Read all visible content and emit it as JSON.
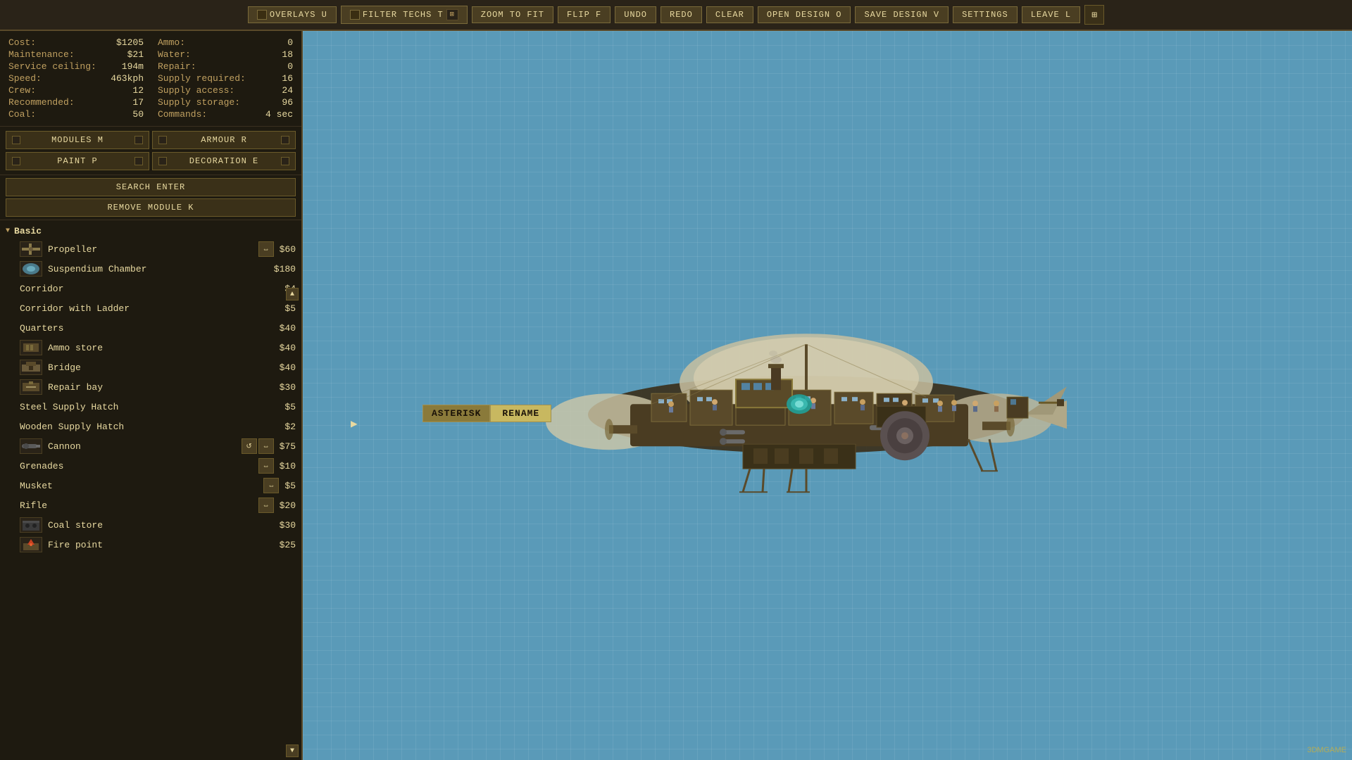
{
  "toolbar": {
    "buttons": [
      {
        "id": "overlays",
        "label": "Overlays U",
        "has_checkbox": true,
        "shortcut": "U"
      },
      {
        "id": "filter_techs",
        "label": "Filter Techs T",
        "has_checkbox": true,
        "shortcut": "T"
      },
      {
        "id": "zoom_fit",
        "label": "Zoom to fit",
        "shortcut": ""
      },
      {
        "id": "flip",
        "label": "Flip F",
        "shortcut": "F"
      },
      {
        "id": "undo",
        "label": "Undo",
        "shortcut": ""
      },
      {
        "id": "redo",
        "label": "Redo",
        "shortcut": ""
      },
      {
        "id": "clear",
        "label": "Clear",
        "shortcut": ""
      },
      {
        "id": "open_design",
        "label": "Open design O",
        "shortcut": "O"
      },
      {
        "id": "save_design",
        "label": "Save design V",
        "shortcut": "V"
      },
      {
        "id": "settings",
        "label": "Settings",
        "shortcut": ""
      },
      {
        "id": "leave",
        "label": "Leave L",
        "shortcut": "L"
      }
    ]
  },
  "stats": {
    "left": [
      {
        "label": "Cost:",
        "value": "$1205"
      },
      {
        "label": "Maintenance:",
        "value": "$21"
      },
      {
        "label": "Service ceiling:",
        "value": "194m"
      },
      {
        "label": "Speed:",
        "value": "463kph"
      },
      {
        "label": "Crew:",
        "value": "12"
      },
      {
        "label": "Recommended:",
        "value": "17"
      },
      {
        "label": "Coal:",
        "value": "50"
      }
    ],
    "right": [
      {
        "label": "Ammo:",
        "value": "0"
      },
      {
        "label": "Water:",
        "value": "18"
      },
      {
        "label": "Repair:",
        "value": "0"
      },
      {
        "label": "Supply required:",
        "value": "16"
      },
      {
        "label": "Supply access:",
        "value": "24"
      },
      {
        "label": "Supply storage:",
        "value": "96"
      },
      {
        "label": "Commands:",
        "value": "4 sec"
      }
    ]
  },
  "tabs": [
    {
      "id": "modules",
      "label": "Modules M",
      "shortcut": "M"
    },
    {
      "id": "armour",
      "label": "Armour R",
      "shortcut": "R"
    },
    {
      "id": "paint",
      "label": "Paint P",
      "shortcut": "P"
    },
    {
      "id": "decoration",
      "label": "Decoration E",
      "shortcut": "E"
    }
  ],
  "search_btn": "Search ENTER",
  "remove_btn": "Remove module K",
  "categories": [
    {
      "name": "Basic",
      "expanded": true,
      "items": [
        {
          "name": "Propeller",
          "price": "$60",
          "has_icon": true,
          "has_flip_btn": true
        },
        {
          "name": "Suspendium Chamber",
          "price": "$180",
          "has_icon": true,
          "has_flip_btn": false
        },
        {
          "name": "Corridor",
          "price": "$4",
          "has_icon": false,
          "has_flip_btn": false
        },
        {
          "name": "Corridor with Ladder",
          "price": "$5",
          "has_icon": false,
          "has_flip_btn": false
        },
        {
          "name": "Quarters",
          "price": "$40",
          "has_icon": false,
          "has_flip_btn": false
        },
        {
          "name": "Ammo store",
          "price": "$40",
          "has_icon": true,
          "has_flip_btn": false
        },
        {
          "name": "Bridge",
          "price": "$40",
          "has_icon": true,
          "has_flip_btn": false
        },
        {
          "name": "Repair bay",
          "price": "$30",
          "has_icon": true,
          "has_flip_btn": false
        },
        {
          "name": "Steel Supply Hatch",
          "price": "$5",
          "has_icon": false,
          "has_flip_btn": false
        },
        {
          "name": "Wooden Supply Hatch",
          "price": "$2",
          "has_icon": false,
          "has_flip_btn": false
        },
        {
          "name": "Cannon",
          "price": "$75",
          "has_icon": true,
          "has_flip_btn": true,
          "has_rotate_btn": true
        },
        {
          "name": "Grenades",
          "price": "$10",
          "has_icon": false,
          "has_flip_btn": true
        },
        {
          "name": "Musket",
          "price": "$5",
          "has_icon": false,
          "has_flip_btn": true
        },
        {
          "name": "Rifle",
          "price": "$20",
          "has_icon": false,
          "has_flip_btn": true
        },
        {
          "name": "Coal store",
          "price": "$30",
          "has_icon": true,
          "has_flip_btn": false
        },
        {
          "name": "Fire point",
          "price": "$25",
          "has_icon": true,
          "has_flip_btn": false
        }
      ]
    }
  ],
  "rename_dialog": {
    "label": "Asterisk",
    "btn": "Rename"
  },
  "watermark": "3DMGAME"
}
